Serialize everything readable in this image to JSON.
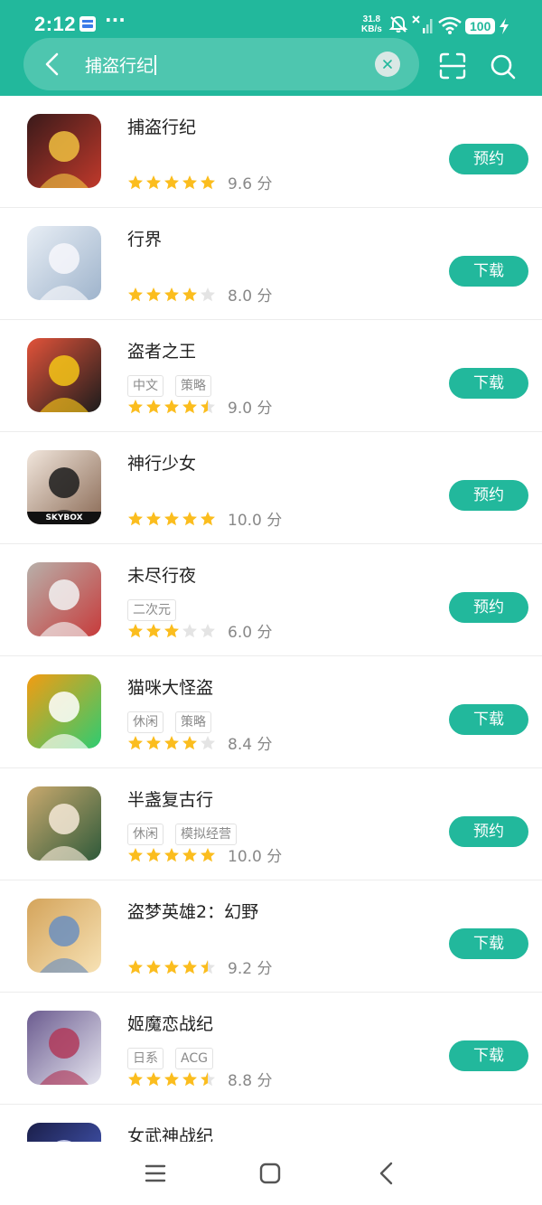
{
  "status_bar": {
    "time": "2:12",
    "dots": "···",
    "net_speed_value": "31.8",
    "net_speed_unit": "KB/s",
    "battery": "100"
  },
  "search": {
    "query": "捕盗行纪"
  },
  "colors": {
    "accent": "#22b89c",
    "star_filled": "#fbbd1e",
    "star_empty": "#e4e4e4"
  },
  "apps": [
    {
      "name": "捕盗行纪",
      "tags": [],
      "stars": 5,
      "score": "9.6",
      "unit": "分",
      "button": "预约"
    },
    {
      "name": "行界",
      "tags": [],
      "stars": 4,
      "score": "8.0",
      "unit": "分",
      "button": "下载"
    },
    {
      "name": "盗者之王",
      "tags": [
        "中文",
        "策略"
      ],
      "stars": 4.5,
      "score": "9.0",
      "unit": "分",
      "button": "下载"
    },
    {
      "name": "神行少女",
      "tags": [],
      "stars": 5,
      "score": "10.0",
      "unit": "分",
      "button": "预约",
      "icon_text": "SKYBOX"
    },
    {
      "name": "未尽行夜",
      "tags": [
        "二次元"
      ],
      "stars": 3,
      "score": "6.0",
      "unit": "分",
      "button": "预约"
    },
    {
      "name": "猫咪大怪盗",
      "tags": [
        "休闲",
        "策略"
      ],
      "stars": 4,
      "score": "8.4",
      "unit": "分",
      "button": "下载"
    },
    {
      "name": "半盏复古行",
      "tags": [
        "休闲",
        "模拟经营"
      ],
      "stars": 5,
      "score": "10.0",
      "unit": "分",
      "button": "预约"
    },
    {
      "name": "盗梦英雄2：幻野",
      "tags": [],
      "stars": 4.5,
      "score": "9.2",
      "unit": "分",
      "button": "下载"
    },
    {
      "name": "姬魔恋战纪",
      "tags": [
        "日系",
        "ACG"
      ],
      "stars": 4.5,
      "score": "8.8",
      "unit": "分",
      "button": "下载"
    },
    {
      "name": "女武神战纪",
      "tags": [],
      "stars": 0,
      "score": "",
      "unit": "",
      "button": ""
    }
  ],
  "icons": {
    "back": "chevron-left-icon",
    "clear": "close-icon",
    "scan": "scan-icon",
    "search": "search-icon",
    "nav_menu": "menu-icon",
    "nav_home": "home-square-icon",
    "nav_back": "nav-back-icon"
  }
}
